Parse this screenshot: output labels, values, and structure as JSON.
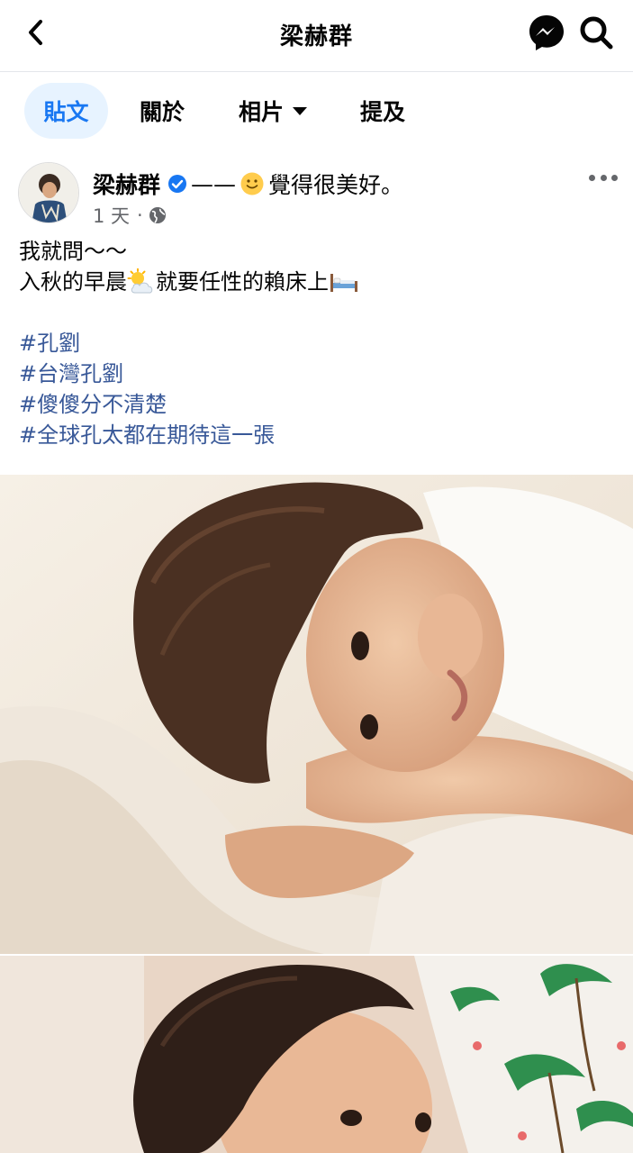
{
  "header": {
    "title": "梁赫群",
    "back_icon": "chevron-left-icon",
    "messenger_icon": "messenger-icon",
    "search_icon": "search-icon"
  },
  "tabs": [
    {
      "label": "貼文",
      "active": true
    },
    {
      "label": "關於",
      "active": false
    },
    {
      "label": "相片",
      "active": false,
      "has_dropdown": true
    },
    {
      "label": "提及",
      "active": false
    }
  ],
  "post": {
    "author": "梁赫群",
    "verified": true,
    "dash": "——",
    "feeling": "覺得很美好。",
    "time": "1 天",
    "separator": "·",
    "privacy_icon": "globe-icon",
    "line1": "我就問～～",
    "line2_prefix": "入秋的早晨",
    "line2_mid": "就要任性的賴床上",
    "hashtags": [
      "#孔劉",
      "#台灣孔劉",
      "#傻傻分不清楚",
      "#全球孔太都在期待這一張"
    ]
  },
  "colors": {
    "accent": "#1877f2",
    "tab_active_bg": "#e7f3ff",
    "hashtag": "#385898",
    "secondary_text": "#65676b"
  }
}
